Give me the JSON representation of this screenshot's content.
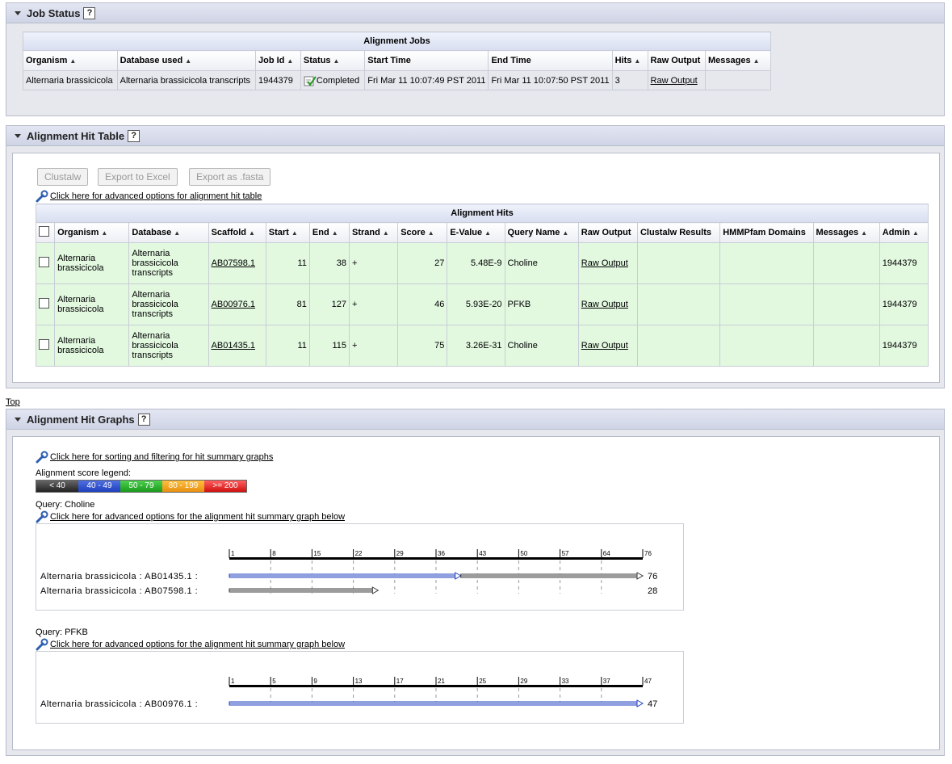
{
  "job_status": {
    "title": "Job Status",
    "help": "?",
    "table_caption": "Alignment Jobs",
    "columns": [
      "Organism",
      "Database used",
      "Job Id",
      "Status",
      "Start Time",
      "End Time",
      "Hits",
      "Raw Output",
      "Messages"
    ],
    "row": {
      "organism": "Alternaria brassicicola",
      "database": "Alternaria brassicicola transcripts",
      "job_id": "1944379",
      "status": "Completed",
      "start_time": "Fri Mar 11 10:07:49 PST 2011",
      "end_time": "Fri Mar 11 10:07:50 PST 2011",
      "hits": "3",
      "raw_output": "Raw Output",
      "messages": ""
    }
  },
  "hit_table": {
    "title": "Alignment Hit Table",
    "help": "?",
    "buttons": {
      "clustalw": "Clustalw",
      "excel": "Export to Excel",
      "fasta": "Export as .fasta"
    },
    "advanced_link": "Click here for advanced options for alignment hit table",
    "table_caption": "Alignment Hits",
    "columns": [
      "Organism",
      "Database",
      "Scaffold",
      "Start",
      "End",
      "Strand",
      "Score",
      "E-Value",
      "Query Name",
      "Raw Output",
      "Clustalw Results",
      "HMMPfam Domains",
      "Messages",
      "Admin"
    ],
    "rows": [
      {
        "organism": "Alternaria brassicicola",
        "database": "Alternaria brassicicola transcripts",
        "scaffold": "AB07598.1",
        "start": "11",
        "end": "38",
        "strand": "+",
        "score": "27",
        "evalue": "5.48E-9",
        "query": "Choline",
        "raw": "Raw Output",
        "clustalw": "",
        "hmm": "",
        "messages": "",
        "admin": "1944379"
      },
      {
        "organism": "Alternaria brassicicola",
        "database": "Alternaria brassicicola transcripts",
        "scaffold": "AB00976.1",
        "start": "81",
        "end": "127",
        "strand": "+",
        "score": "46",
        "evalue": "5.93E-20",
        "query": "PFKB",
        "raw": "Raw Output",
        "clustalw": "",
        "hmm": "",
        "messages": "",
        "admin": "1944379"
      },
      {
        "organism": "Alternaria brassicicola",
        "database": "Alternaria brassicicola transcripts",
        "scaffold": "AB01435.1",
        "start": "11",
        "end": "115",
        "strand": "+",
        "score": "75",
        "evalue": "3.26E-31",
        "query": "Choline",
        "raw": "Raw Output",
        "clustalw": "",
        "hmm": "",
        "messages": "",
        "admin": "1944379"
      }
    ]
  },
  "top_link": "Top",
  "hit_graphs": {
    "title": "Alignment Hit Graphs",
    "help": "?",
    "sort_link": "Click here for sorting and filtering for hit summary graphs",
    "legend_label": "Alignment score legend:",
    "legend": [
      {
        "label": "< 40",
        "color": "#3a3a3a"
      },
      {
        "label": "40 - 49",
        "color": "#1f3fbf"
      },
      {
        "label": "50 - 79",
        "color": "#22aa22"
      },
      {
        "label": "80 - 199",
        "color": "#f0a020"
      },
      {
        "label": ">= 200",
        "color": "#e02020"
      }
    ],
    "queries": [
      {
        "query_label": "Query: Choline",
        "adv_link": "Click here for advanced options for the alignment hit summary graph below",
        "length": 76,
        "ticks": [
          "1",
          "8",
          "15",
          "22",
          "29",
          "36",
          "43",
          "50",
          "57",
          "64",
          "76"
        ],
        "hits": [
          {
            "label": "Alternaria brassicicola : AB01435.1 :",
            "score": "76",
            "segments": [
              {
                "from": 1,
                "to": 43,
                "color": "#1f3fbf"
              },
              {
                "from": 43,
                "to": 76,
                "color": "#3a3a3a"
              }
            ]
          },
          {
            "label": "Alternaria brassicicola : AB07598.1 :",
            "score": "28",
            "segments": [
              {
                "from": 1,
                "to": 28,
                "color": "#3a3a3a"
              }
            ]
          }
        ]
      },
      {
        "query_label": "Query: PFKB",
        "adv_link": "Click here for advanced options for the alignment hit summary graph below",
        "length": 47,
        "ticks": [
          "1",
          "5",
          "9",
          "13",
          "17",
          "21",
          "25",
          "29",
          "33",
          "37",
          "47"
        ],
        "hits": [
          {
            "label": "Alternaria brassicicola : AB00976.1 :",
            "score": "47",
            "segments": [
              {
                "from": 1,
                "to": 47,
                "color": "#1f3fbf"
              }
            ]
          }
        ]
      }
    ]
  }
}
